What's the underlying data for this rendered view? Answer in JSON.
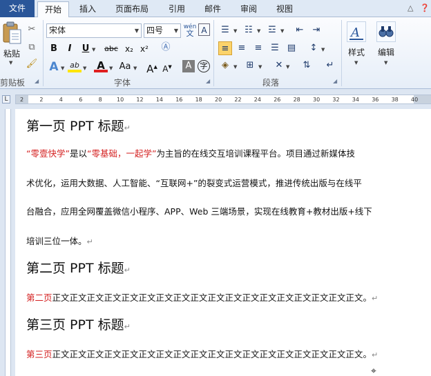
{
  "tabs": {
    "file": "文件",
    "home": "开始",
    "insert": "插入",
    "page_layout": "页面布局",
    "references": "引用",
    "mailings": "邮件",
    "review": "审阅",
    "view": "视图"
  },
  "ribbon": {
    "clipboard": {
      "paste_label": "粘贴",
      "group_label": "剪贴板"
    },
    "font": {
      "font_name": "宋体",
      "font_size": "四号",
      "phonetic_glyph": "wén",
      "bold": "B",
      "italic": "I",
      "underline": "U",
      "strikethrough": "abc",
      "subscript": "x₂",
      "superscript": "x²",
      "highlight": "ab",
      "font_color": "A",
      "change_case": "Aa",
      "grow_font": "A",
      "shrink_font": "A",
      "char_shading": "A",
      "enclose_char": "字",
      "group_label": "字体"
    },
    "paragraph": {
      "group_label": "段落"
    },
    "styles": {
      "label": "样式"
    },
    "editing": {
      "label": "编辑"
    }
  },
  "ruler": {
    "numbers": [
      "2",
      "2",
      "4",
      "6",
      "8",
      "10",
      "12",
      "14",
      "16",
      "18",
      "20",
      "22",
      "24",
      "26",
      "28",
      "30",
      "32",
      "34",
      "36",
      "38",
      "40"
    ],
    "tab_marker": "L"
  },
  "document": {
    "heading1": "第一页 PPT 标题",
    "para1": {
      "q1_open": "“",
      "q1_text": "零壹快学",
      "q1_close": "”",
      "mid1": "是以",
      "q2_open": "“",
      "q2_text": "零基础，一起学",
      "q2_close": "”",
      "rest1": "为主旨的在线交互培训课程平台。项目通过新媒体技",
      "line2": "术优化，运用大数据、人工智能、“互联网+”的裂变式运营模式，推进传统出版与在线平",
      "line3": "台融合，应用全网覆盖微信小程序、APP、Web 三端场景，实现在线教育+教材出版+线下",
      "line4": "培训三位一体。"
    },
    "heading2": "第二页 PPT 标题",
    "para2": {
      "red": "第二页",
      "body": "正文正文正文正文正文正文正文正文正文正文正文正文正文正文正文正文正文正文。"
    },
    "heading3": "第三页 PPT 标题",
    "para3": {
      "red": "第三页",
      "body": "正文正文正文正文正文正文正文正文正文正文正文正文正文正文正文正文正文正文。"
    },
    "para_mark": "↵"
  },
  "colors": {
    "file_tab": "#2a5699",
    "accent_red": "#d42020",
    "ribbon_bg": "#e6eef8"
  }
}
